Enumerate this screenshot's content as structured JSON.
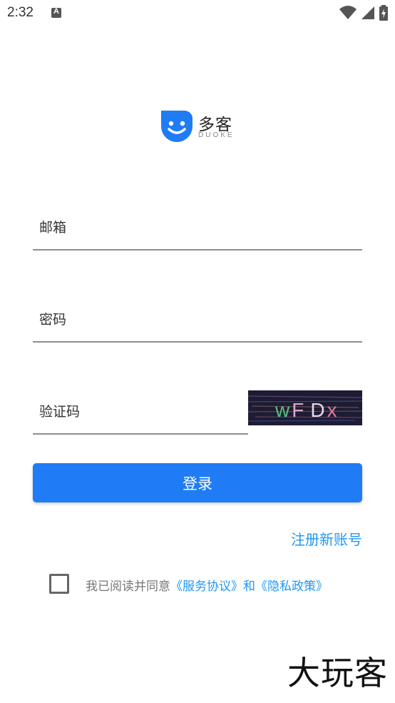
{
  "status_bar": {
    "time": "2:32",
    "icons": [
      "notification-a-icon",
      "wifi-icon",
      "signal-icon",
      "battery-charging-icon"
    ]
  },
  "logo": {
    "name": "多客",
    "subtitle": "DUOKE",
    "brand_color": "#1f7cf5"
  },
  "form": {
    "email_label": "邮箱",
    "password_label": "密码",
    "captcha_label": "验证码",
    "captcha_image_text": "wFDx"
  },
  "login_button": {
    "label": "登录"
  },
  "register_link": {
    "label": "注册新账号"
  },
  "agreement": {
    "checked": false,
    "prefix": "我已阅读并同意",
    "service_link": "《服务协议》",
    "conjunction": "和",
    "privacy_link": "《隐私政策》"
  },
  "watermark": "大玩客",
  "colors": {
    "accent": "#1f7cf5",
    "link": "#2196f3",
    "underline": "#8e8e8e"
  }
}
